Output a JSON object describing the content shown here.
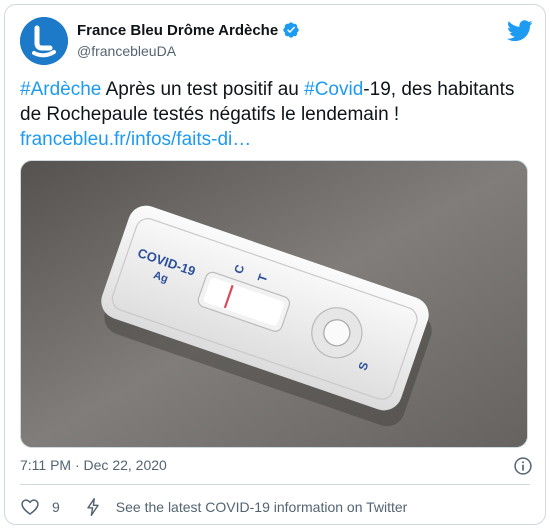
{
  "author": {
    "display_name": "France Bleu Drôme Ardèche",
    "handle": "@francebleuDA",
    "verified": true
  },
  "tweet": {
    "segments": [
      {
        "text": "#Ardèche",
        "kind": "hashtag"
      },
      {
        "text": " Après un test positif au ",
        "kind": "text"
      },
      {
        "text": "#Covid",
        "kind": "hashtag"
      },
      {
        "text": "-19, des habitants de Rochepaule testés négatifs le lendemain !",
        "kind": "text"
      },
      {
        "text": "francebleu.fr/infos/faits-di…",
        "kind": "link"
      }
    ]
  },
  "media": {
    "test_label_line1": "COVID-19",
    "test_label_line2": "Ag",
    "window_label_c": "C",
    "window_label_t": "T",
    "sample_label_s": "S"
  },
  "meta": {
    "timestamp": "7:11 PM · Dec 22, 2020"
  },
  "actions": {
    "like_count": "9",
    "covid_info": "See the latest COVID-19 information on Twitter"
  },
  "colors": {
    "accent": "#1d9bf0",
    "like_red": "#f91880",
    "avatar_blue": "#1d7ac8"
  },
  "icons": [
    "france-bleu-logo-icon",
    "verified-badge-icon",
    "twitter-bird-icon",
    "info-icon",
    "heart-icon",
    "bolt-icon"
  ]
}
